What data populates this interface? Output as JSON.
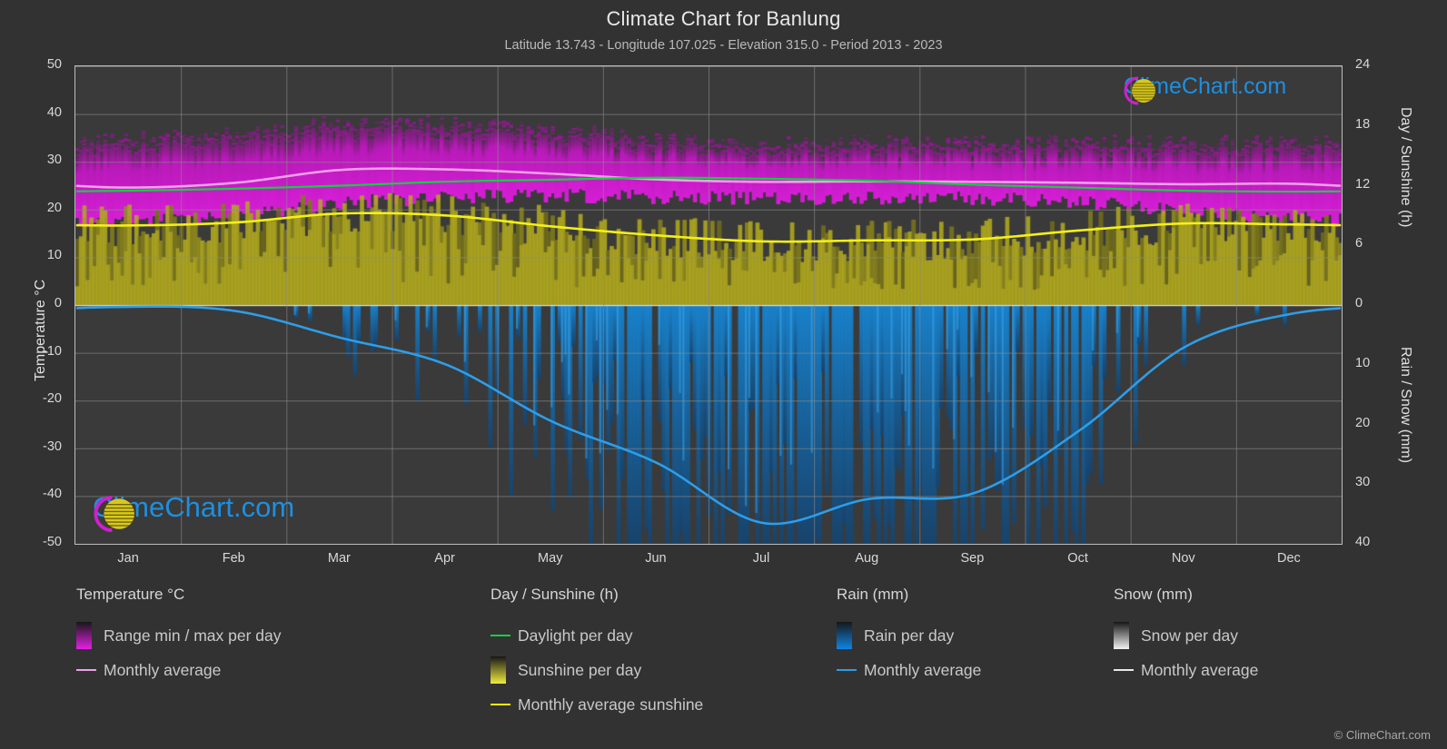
{
  "header": {
    "title": "Climate Chart for Banlung",
    "subtitle": "Latitude 13.743 - Longitude 107.025 - Elevation 315.0 - Period 2013 - 2023"
  },
  "axes": {
    "left_title": "Temperature °C",
    "right_title_top": "Day / Sunshine (h)",
    "right_title_bottom": "Rain / Snow (mm)",
    "left_ticks": [
      "50",
      "40",
      "30",
      "20",
      "10",
      "0",
      "-10",
      "-20",
      "-30",
      "-40",
      "-50"
    ],
    "right_ticks_top": [
      "24",
      "18",
      "12",
      "6",
      "0"
    ],
    "right_ticks_bottom": [
      "0",
      "10",
      "20",
      "30",
      "40"
    ],
    "x_ticks": [
      "Jan",
      "Feb",
      "Mar",
      "Apr",
      "May",
      "Jun",
      "Jul",
      "Aug",
      "Sep",
      "Oct",
      "Nov",
      "Dec"
    ]
  },
  "legend": {
    "columns": [
      {
        "heading": "Temperature °C",
        "items": [
          {
            "label": "Range min / max per day",
            "symbol": "gradient-swatch",
            "color": "#e51fe5"
          },
          {
            "label": "Monthly average",
            "symbol": "line-dash",
            "color": "#ef9fe7"
          }
        ]
      },
      {
        "heading": "Day / Sunshine (h)",
        "items": [
          {
            "label": "Daylight per day",
            "symbol": "line-dash",
            "color": "#13d13f"
          },
          {
            "label": "Sunshine per day",
            "symbol": "gradient-swatch",
            "color": "#f0ec3c"
          },
          {
            "label": "Monthly average sunshine",
            "symbol": "line-dash",
            "color": "#f4f018"
          }
        ]
      },
      {
        "heading": "Rain (mm)",
        "items": [
          {
            "label": "Rain per day",
            "symbol": "gradient-swatch",
            "color": "#0d86e8"
          },
          {
            "label": "Monthly average",
            "symbol": "line-dash",
            "color": "#2e9de8"
          }
        ]
      },
      {
        "heading": "Snow (mm)",
        "items": [
          {
            "label": "Snow per day",
            "symbol": "gradient-swatch",
            "color": "#f2f2f2"
          },
          {
            "label": "Monthly average",
            "symbol": "line-dash",
            "color": "#e8e8e8"
          }
        ]
      }
    ]
  },
  "watermark": {
    "text": "ClimeChart.com",
    "arc_color": "#cc22cc",
    "sphere_color": "#e8d21a",
    "text_color": "#1e8fe0"
  },
  "copyright": "© ClimeChart.com",
  "colors": {
    "background": "#323232",
    "plot_background": "#3a3a3a",
    "gridline": "#8c8c8c",
    "axis": "#bdbdbd",
    "text": "#d8d8d8",
    "temp_range": "#e51fe5",
    "temp_avg": "#ef9fe7",
    "daylight": "#13d13f",
    "sunshine_area": "#b5ad22",
    "sunshine_avg": "#f4f018",
    "rain_bar": "#1877c4",
    "rain_avg": "#2e9de8"
  },
  "chart_data": {
    "type": "area",
    "title": "Climate Chart for Banlung",
    "subtitle": "Latitude 13.743 - Longitude 107.025 - Elevation 315.0 - Period 2013 - 2023",
    "xlabel": "",
    "ylabel": "Temperature °C",
    "x": [
      "Jan",
      "Feb",
      "Mar",
      "Apr",
      "May",
      "Jun",
      "Jul",
      "Aug",
      "Sep",
      "Oct",
      "Nov",
      "Dec"
    ],
    "ylim_temperature_c": [
      -50,
      50
    ],
    "ylim_day_sunshine_h": [
      0,
      24
    ],
    "ylim_rain_snow_mm": [
      0,
      40
    ],
    "grid": true,
    "legend_position": "below",
    "series": [
      {
        "name": "Monthly average temperature (°C)",
        "axis": "temperature",
        "color": "#ef9fe7",
        "values": [
          24.6,
          25.6,
          28.3,
          28.4,
          27.5,
          26.3,
          25.8,
          25.9,
          25.8,
          25.6,
          25.3,
          25.4
        ]
      },
      {
        "name": "Daily temperature range max (°C)",
        "axis": "temperature",
        "color": "#e51fe5",
        "values": [
          32.0,
          33.4,
          35.5,
          35.2,
          34.0,
          32.2,
          31.5,
          31.4,
          31.4,
          31.4,
          31.2,
          31.3
        ]
      },
      {
        "name": "Daily temperature range min (°C)",
        "axis": "temperature",
        "color": "#e51fe5",
        "values": [
          17.5,
          18.5,
          21.3,
          22.5,
          22.8,
          22.6,
          22.4,
          22.4,
          22.3,
          21.6,
          19.8,
          18.2
        ]
      },
      {
        "name": "Daylight per day (h)",
        "axis": "day_sunshine",
        "color": "#13d13f",
        "values": [
          11.5,
          11.7,
          12.0,
          12.4,
          12.6,
          12.8,
          12.7,
          12.5,
          12.1,
          11.8,
          11.5,
          11.4
        ]
      },
      {
        "name": "Monthly average sunshine (h)",
        "axis": "day_sunshine",
        "color": "#f4f018",
        "values": [
          8.0,
          8.3,
          9.2,
          9.0,
          7.9,
          7.0,
          6.4,
          6.5,
          6.6,
          7.5,
          8.2,
          8.1
        ]
      },
      {
        "name": "Monthly average rain (mm)",
        "axis": "rain_snow",
        "color": "#2e9de8",
        "values": [
          0.3,
          1.0,
          5.5,
          10.0,
          19.5,
          26.5,
          36.5,
          32.5,
          31.5,
          21.0,
          7.0,
          1.5
        ]
      },
      {
        "name": "Monthly average snow (mm)",
        "axis": "rain_snow",
        "color": "#e8e8e8",
        "values": [
          0,
          0,
          0,
          0,
          0,
          0,
          0,
          0,
          0,
          0,
          0,
          0
        ]
      }
    ]
  }
}
